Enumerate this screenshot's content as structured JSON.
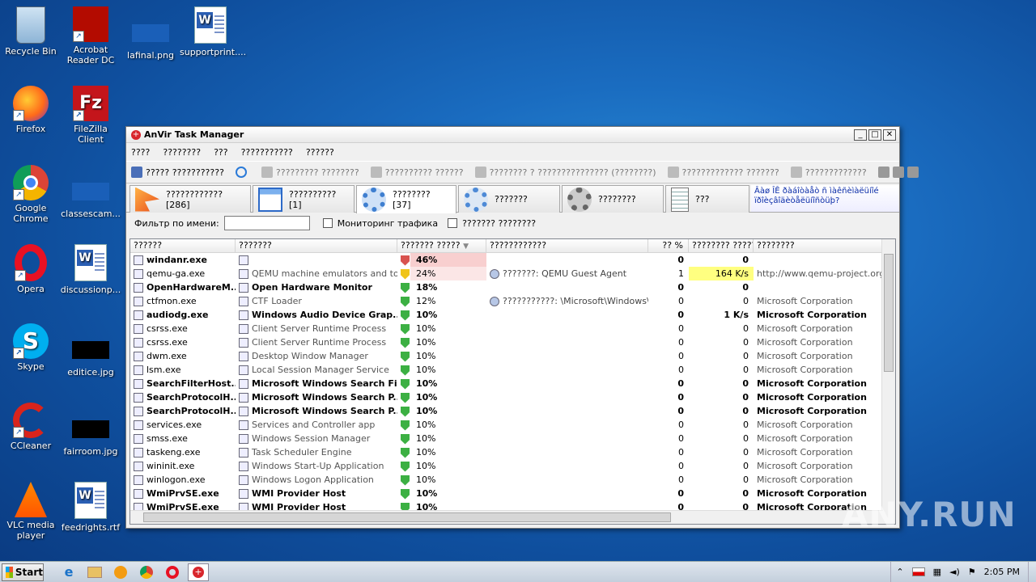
{
  "desktop": {
    "icons": [
      {
        "label": "Recycle Bin",
        "icon": "recycle-bin-icon"
      },
      {
        "label": "Acrobat Reader DC",
        "icon": "acrobat-icon"
      },
      {
        "label": "lafinal.png",
        "icon": "image-file-icon"
      },
      {
        "label": "supportprint....",
        "icon": "word-doc-icon"
      },
      {
        "label": "Firefox",
        "icon": "firefox-icon"
      },
      {
        "label": "FileZilla Client",
        "icon": "filezilla-icon"
      },
      {
        "label": "Google Chrome",
        "icon": "chrome-icon"
      },
      {
        "label": "classescam...",
        "icon": "image-file-icon"
      },
      {
        "label": "Opera",
        "icon": "opera-icon"
      },
      {
        "label": "discussionp...",
        "icon": "word-doc-icon"
      },
      {
        "label": "Skype",
        "icon": "skype-icon"
      },
      {
        "label": "editice.jpg",
        "icon": "image-file-icon"
      },
      {
        "label": "CCleaner",
        "icon": "ccleaner-icon"
      },
      {
        "label": "fairroom.jpg",
        "icon": "image-file-icon"
      },
      {
        "label": "VLC media player",
        "icon": "vlc-icon"
      },
      {
        "label": "feedrights.rtf",
        "icon": "word-doc-icon"
      }
    ]
  },
  "window": {
    "title": "AnVir Task Manager",
    "menu": [
      "????",
      "????????",
      "???",
      "???????????",
      "??????"
    ],
    "toolbar": [
      "????? ???????????",
      "????????? ????????",
      "?????????? ??????",
      "???????? ? ??????????????? (????????)",
      "????????????? ???????",
      "?????????????"
    ],
    "tabs": [
      {
        "label": "???????????? [286]",
        "icon": "startup-icon"
      },
      {
        "label": "?????????? [1]",
        "icon": "windows-icon"
      },
      {
        "label": "???????? [37]",
        "icon": "processes-gear-icon"
      },
      {
        "label": "???????",
        "icon": "services-gear-icon"
      },
      {
        "label": "????????",
        "icon": "drivers-icon"
      },
      {
        "label": "???",
        "icon": "log-icon"
      }
    ],
    "info_text": "Âàø ÎÊ ðàáîòàåò ñ ìàêñèìàëüíîé ïðîèçâîäèòåëüíîñòüþ?",
    "filter": {
      "label": "Фильтр по имени:",
      "value": "",
      "traffic_label": "Мониторинг трафика",
      "other_label": "??????? ????????"
    },
    "columns": [
      "??????",
      "???????",
      "??????? ?????",
      "????????????",
      "?? %",
      "???????? ?????",
      "????????"
    ],
    "rows": [
      {
        "name": "windanr.exe",
        "desc": "",
        "cpu": "46%",
        "info": "",
        "n1": "0",
        "traffic": "0",
        "company": "",
        "bold": true,
        "hl": "red"
      },
      {
        "name": "qemu-ga.exe",
        "desc": "QEMU machine emulators and tools",
        "cpu": "24%",
        "info": "???????: QEMU Guest Agent",
        "n1": "1",
        "traffic": "164 K/s",
        "company": "http://www.qemu-project.org",
        "bold": false,
        "hl": "pink"
      },
      {
        "name": "OpenHardwareM...",
        "desc": "Open Hardware Monitor",
        "cpu": "18%",
        "info": "",
        "n1": "0",
        "traffic": "0",
        "company": "",
        "bold": true,
        "hl": ""
      },
      {
        "name": "ctfmon.exe",
        "desc": "CTF Loader",
        "cpu": "12%",
        "info": "???????????: \\Microsoft\\Windows\\Te...",
        "n1": "0",
        "traffic": "0",
        "company": "Microsoft Corporation",
        "bold": false,
        "hl": ""
      },
      {
        "name": "audiodg.exe",
        "desc": "Windows Audio Device Grap...",
        "cpu": "10%",
        "info": "",
        "n1": "0",
        "traffic": "1 K/s",
        "company": "Microsoft Corporation",
        "bold": true,
        "hl": ""
      },
      {
        "name": "csrss.exe",
        "desc": "Client Server Runtime Process",
        "cpu": "10%",
        "info": "",
        "n1": "0",
        "traffic": "0",
        "company": "Microsoft Corporation",
        "bold": false,
        "hl": ""
      },
      {
        "name": "csrss.exe",
        "desc": "Client Server Runtime Process",
        "cpu": "10%",
        "info": "",
        "n1": "0",
        "traffic": "0",
        "company": "Microsoft Corporation",
        "bold": false,
        "hl": ""
      },
      {
        "name": "dwm.exe",
        "desc": "Desktop Window Manager",
        "cpu": "10%",
        "info": "",
        "n1": "0",
        "traffic": "0",
        "company": "Microsoft Corporation",
        "bold": false,
        "hl": ""
      },
      {
        "name": "lsm.exe",
        "desc": "Local Session Manager Service",
        "cpu": "10%",
        "info": "",
        "n1": "0",
        "traffic": "0",
        "company": "Microsoft Corporation",
        "bold": false,
        "hl": ""
      },
      {
        "name": "SearchFilterHost....",
        "desc": "Microsoft Windows Search Fi...",
        "cpu": "10%",
        "info": "",
        "n1": "0",
        "traffic": "0",
        "company": "Microsoft Corporation",
        "bold": true,
        "hl": ""
      },
      {
        "name": "SearchProtocolH...",
        "desc": "Microsoft Windows Search P...",
        "cpu": "10%",
        "info": "",
        "n1": "0",
        "traffic": "0",
        "company": "Microsoft Corporation",
        "bold": true,
        "hl": ""
      },
      {
        "name": "SearchProtocolH...",
        "desc": "Microsoft Windows Search P...",
        "cpu": "10%",
        "info": "",
        "n1": "0",
        "traffic": "0",
        "company": "Microsoft Corporation",
        "bold": true,
        "hl": ""
      },
      {
        "name": "services.exe",
        "desc": "Services and Controller app",
        "cpu": "10%",
        "info": "",
        "n1": "0",
        "traffic": "0",
        "company": "Microsoft Corporation",
        "bold": false,
        "hl": ""
      },
      {
        "name": "smss.exe",
        "desc": "Windows Session Manager",
        "cpu": "10%",
        "info": "",
        "n1": "0",
        "traffic": "0",
        "company": "Microsoft Corporation",
        "bold": false,
        "hl": ""
      },
      {
        "name": "taskeng.exe",
        "desc": "Task Scheduler Engine",
        "cpu": "10%",
        "info": "",
        "n1": "0",
        "traffic": "0",
        "company": "Microsoft Corporation",
        "bold": false,
        "hl": ""
      },
      {
        "name": "wininit.exe",
        "desc": "Windows Start-Up Application",
        "cpu": "10%",
        "info": "",
        "n1": "0",
        "traffic": "0",
        "company": "Microsoft Corporation",
        "bold": false,
        "hl": ""
      },
      {
        "name": "winlogon.exe",
        "desc": "Windows Logon Application",
        "cpu": "10%",
        "info": "",
        "n1": "0",
        "traffic": "0",
        "company": "Microsoft Corporation",
        "bold": false,
        "hl": ""
      },
      {
        "name": "WmiPrvSE.exe",
        "desc": "WMI Provider Host",
        "cpu": "10%",
        "info": "",
        "n1": "0",
        "traffic": "0",
        "company": "Microsoft Corporation",
        "bold": true,
        "hl": ""
      },
      {
        "name": "WmiPrvSE.exe",
        "desc": "WMI Provider Host",
        "cpu": "10%",
        "info": "",
        "n1": "0",
        "traffic": "0",
        "company": "Microsoft Corporation",
        "bold": true,
        "hl": ""
      }
    ]
  },
  "taskbar": {
    "start_label": "Start",
    "clock": "2:05 PM",
    "apps": [
      "ie-icon",
      "explorer-icon",
      "media-player-icon",
      "chrome-icon",
      "opera-icon",
      "anvir-icon"
    ]
  },
  "watermark": "ANY.RUN"
}
